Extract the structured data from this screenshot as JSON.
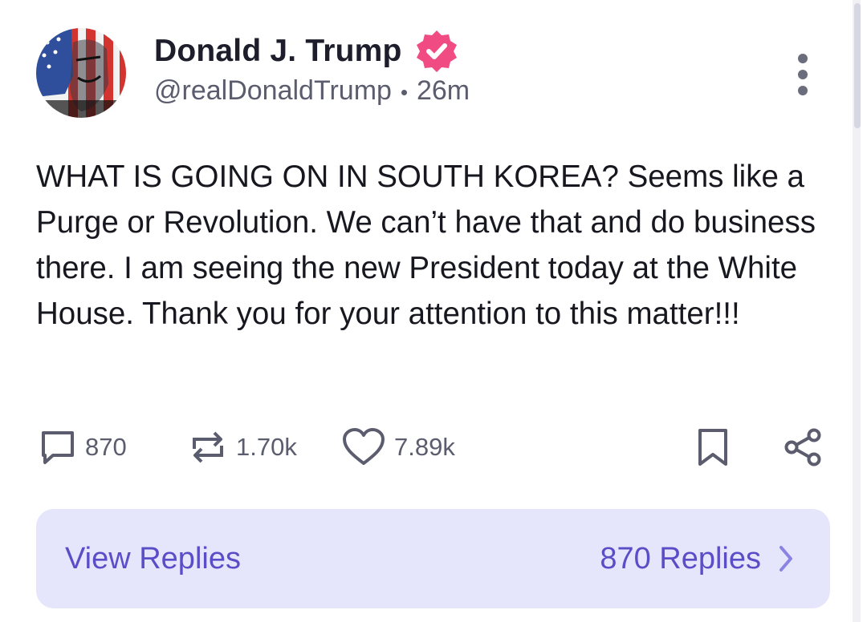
{
  "post": {
    "author": {
      "display_name": "Donald J. Trump",
      "handle": "@realDonaldTrump",
      "verified": true,
      "avatar": "flag-portrait-avatar"
    },
    "time_ago": "26m",
    "body": "WHAT IS GOING ON IN SOUTH KOREA? Seems like a Purge or Revolution. We can’t have that and do business there. I am seeing the new President today at the White House. Thank you for your attention to this matter!!!",
    "actions": {
      "replies": {
        "icon": "reply-icon",
        "count": "870"
      },
      "reposts": {
        "icon": "repost-icon",
        "count": "1.70k"
      },
      "likes": {
        "icon": "heart-icon",
        "count": "7.89k"
      },
      "bookmark": {
        "icon": "bookmark-icon"
      },
      "share": {
        "icon": "share-icon"
      }
    },
    "more_menu_icon": "more-vertical-icon",
    "replies_bar": {
      "label": "View Replies",
      "count_label": "870 Replies",
      "icon": "chevron-right-icon"
    }
  },
  "colors": {
    "verified_badge": "#f04b83",
    "accent": "#5a4dc8",
    "replies_bar_bg": "#e5e6fc",
    "muted_text": "#5b5d6e",
    "body_text": "#17171f"
  }
}
